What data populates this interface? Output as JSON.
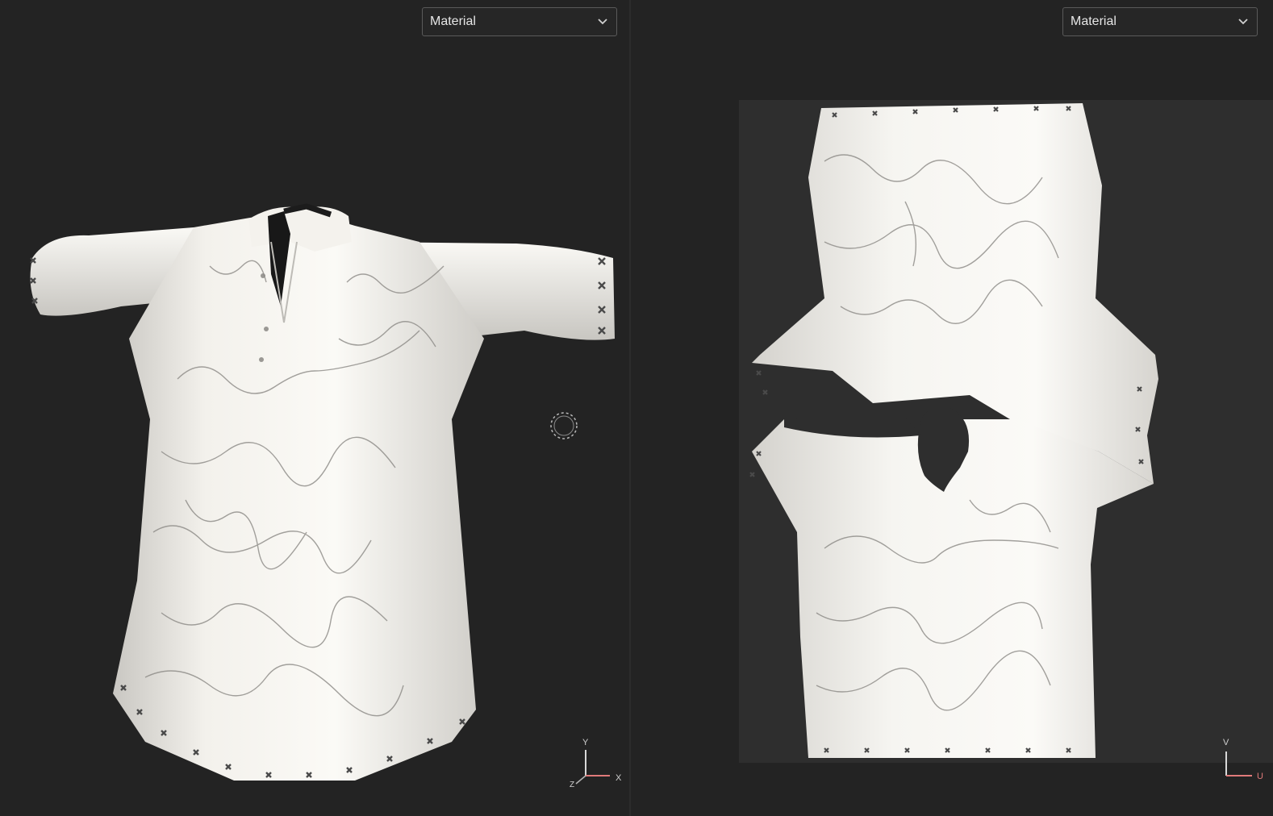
{
  "viewport_3d": {
    "shading_mode": "Material",
    "axis_labels": {
      "y": "Y",
      "x": "X",
      "z": "Z"
    }
  },
  "viewport_uv": {
    "shading_mode": "Material",
    "axis_labels": {
      "v": "V",
      "u": "U"
    }
  },
  "icons": {
    "dropdown": "chevron-down-icon",
    "navigation": "orbit-target-icon",
    "gizmo": "axis-gizmo-icon"
  },
  "colors": {
    "background": "#232323",
    "uv_area": "#2e2e2e",
    "fabric": "#f2f0ea",
    "axis_x": "#e07a7a",
    "axis_y": "#d8d8d8"
  }
}
